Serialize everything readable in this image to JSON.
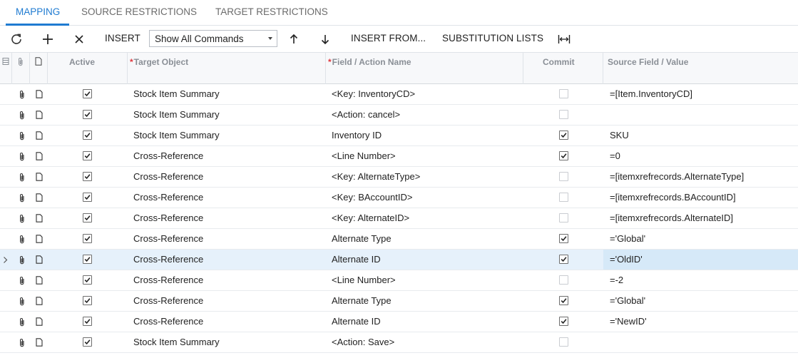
{
  "tabs": [
    {
      "label": "MAPPING",
      "active": true
    },
    {
      "label": "SOURCE RESTRICTIONS",
      "active": false
    },
    {
      "label": "TARGET RESTRICTIONS",
      "active": false
    }
  ],
  "toolbar": {
    "refresh_icon": "refresh-icon",
    "add_icon": "plus-icon",
    "delete_icon": "close-icon",
    "insert_label": "INSERT",
    "commands_select_value": "Show All Commands",
    "move_up_icon": "arrow-up-icon",
    "move_down_icon": "arrow-down-icon",
    "insert_from_label": "INSERT FROM...",
    "substitution_lists_label": "SUBSTITUTION LISTS",
    "fit_columns_icon": "fit-columns-icon"
  },
  "grid": {
    "columns": {
      "active": "Active",
      "target_object": "Target Object",
      "field_action": "Field / Action Name",
      "commit": "Commit",
      "source_field": "Source Field / Value"
    },
    "rows": [
      {
        "active": true,
        "target": "Stock Item Summary",
        "field": "<Key: InventoryCD>",
        "commit": false,
        "source": "=[Item.InventoryCD]",
        "selected": false
      },
      {
        "active": true,
        "target": "Stock Item Summary",
        "field": "<Action: cancel>",
        "commit": false,
        "source": "",
        "selected": false
      },
      {
        "active": true,
        "target": "Stock Item Summary",
        "field": "Inventory ID",
        "commit": true,
        "source": "SKU",
        "selected": false
      },
      {
        "active": true,
        "target": "Cross-Reference",
        "field": "<Line Number>",
        "commit": true,
        "source": "=0",
        "selected": false
      },
      {
        "active": true,
        "target": "Cross-Reference",
        "field": "<Key: AlternateType>",
        "commit": false,
        "source": "=[itemxrefrecords.AlternateType]",
        "selected": false
      },
      {
        "active": true,
        "target": "Cross-Reference",
        "field": "<Key: BAccountID>",
        "commit": false,
        "source": "=[itemxrefrecords.BAccountID]",
        "selected": false
      },
      {
        "active": true,
        "target": "Cross-Reference",
        "field": "<Key: AlternateID>",
        "commit": false,
        "source": "=[itemxrefrecords.AlternateID]",
        "selected": false
      },
      {
        "active": true,
        "target": "Cross-Reference",
        "field": "Alternate Type",
        "commit": true,
        "source": "='Global'",
        "selected": false
      },
      {
        "active": true,
        "target": "Cross-Reference",
        "field": "Alternate ID",
        "commit": true,
        "source": "='OldID'",
        "selected": true
      },
      {
        "active": true,
        "target": "Cross-Reference",
        "field": "<Line Number>",
        "commit": false,
        "source": "=-2",
        "selected": false
      },
      {
        "active": true,
        "target": "Cross-Reference",
        "field": "Alternate Type",
        "commit": true,
        "source": "='Global'",
        "selected": false
      },
      {
        "active": true,
        "target": "Cross-Reference",
        "field": "Alternate ID",
        "commit": true,
        "source": "='NewID'",
        "selected": false
      },
      {
        "active": true,
        "target": "Stock Item Summary",
        "field": "<Action: Save>",
        "commit": false,
        "source": "",
        "selected": false
      }
    ]
  },
  "colors": {
    "accent": "#1f7bd1",
    "required_marker": "#e0383e",
    "selected_row": "#e6f1fb",
    "selected_cell": "#d6e9f8"
  }
}
